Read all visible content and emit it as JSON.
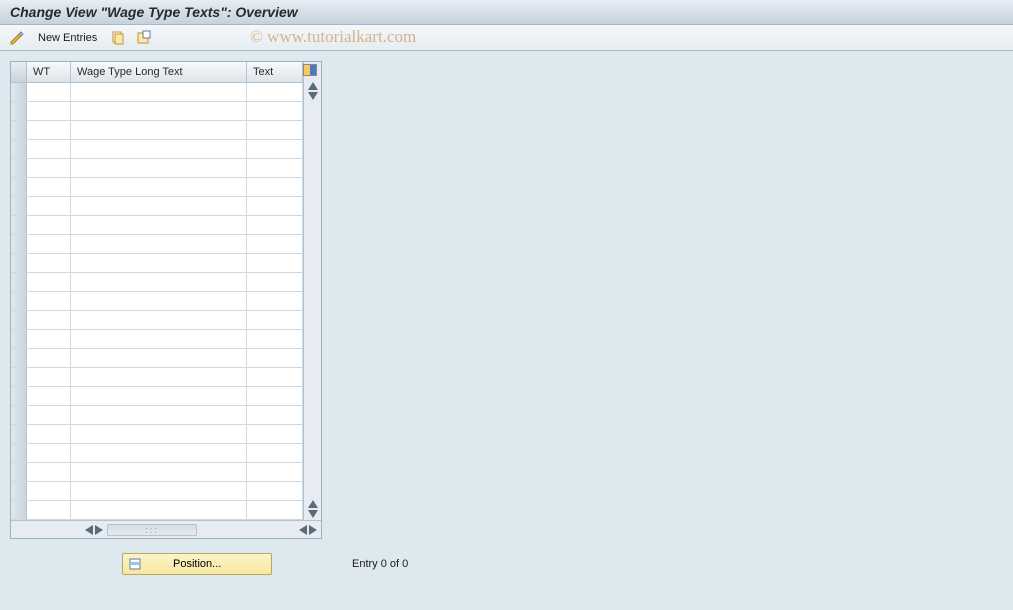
{
  "title": "Change View \"Wage Type Texts\": Overview",
  "watermark": "© www.tutorialkart.com",
  "toolbar": {
    "new_entries_label": "New Entries"
  },
  "table": {
    "columns": {
      "wt": "WT",
      "long_text": "Wage Type Long Text",
      "text": "Text"
    },
    "row_count": 23
  },
  "footer": {
    "position_label": "Position...",
    "entry_status": "Entry 0 of 0"
  }
}
